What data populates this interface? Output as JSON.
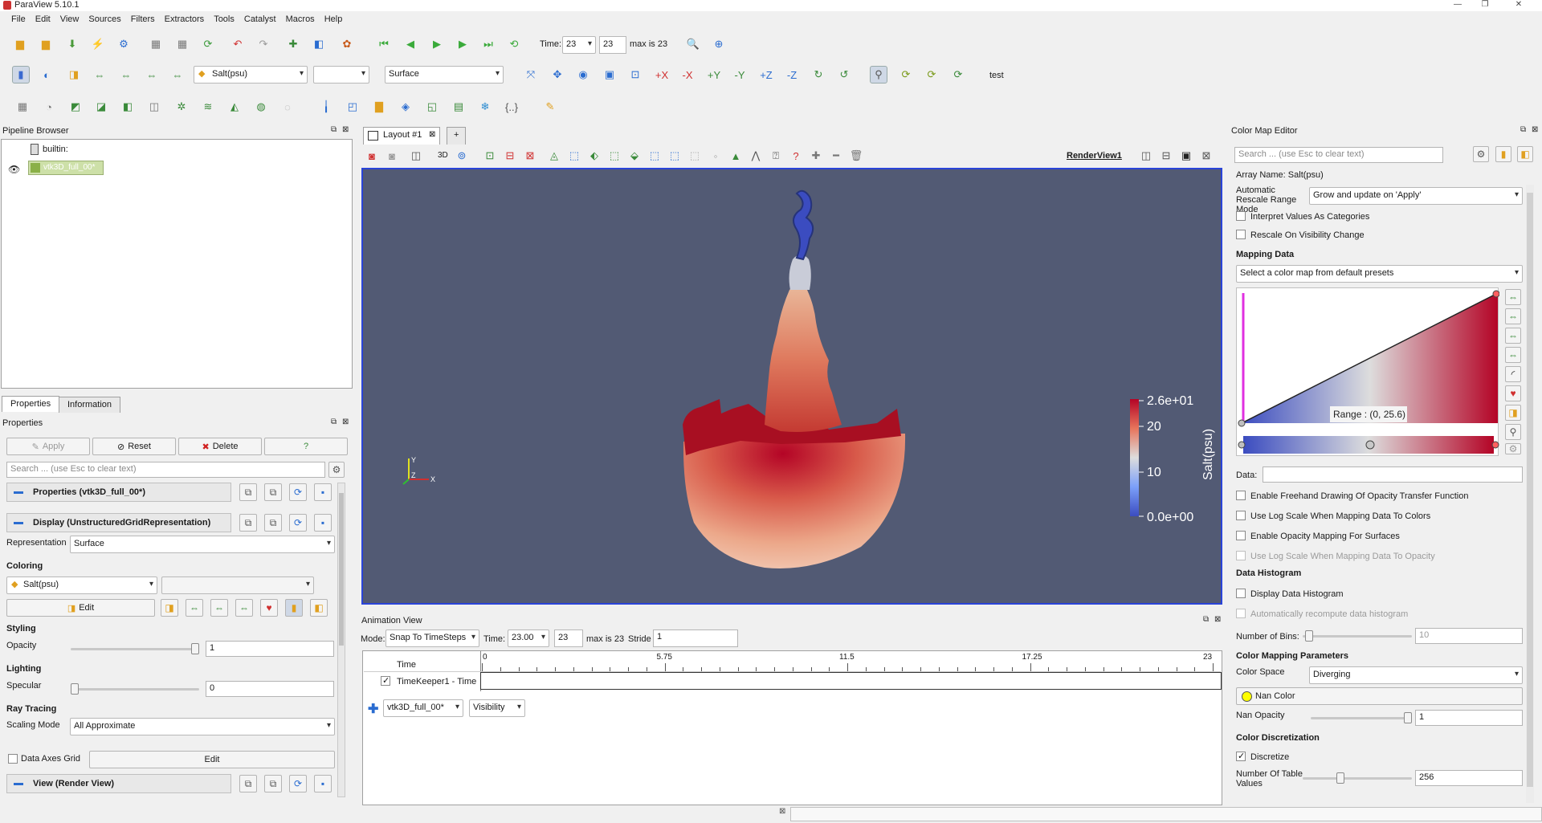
{
  "app": {
    "title": "ParaView 5.10.1"
  },
  "menu": [
    "File",
    "Edit",
    "View",
    "Sources",
    "Filters",
    "Extractors",
    "Tools",
    "Catalyst",
    "Macros",
    "Help"
  ],
  "time_toolbar": {
    "time_label": "Time:",
    "time_combo": "23",
    "time_spin": "23",
    "max_label": "max is 23"
  },
  "display_toolbar": {
    "array": "Salt(psu)",
    "component": "",
    "representation": "Surface",
    "test_label": "test"
  },
  "pipeline": {
    "title": "Pipeline Browser",
    "builtin": "builtin:",
    "source": "vtk3D_full_00*"
  },
  "tabs": {
    "properties": "Properties",
    "information": "Information"
  },
  "properties": {
    "title": "Properties",
    "apply": "Apply",
    "reset": "Reset",
    "delete": "Delete",
    "help": "?",
    "search_placeholder": "Search ... (use Esc to clear text)",
    "group_props": "Properties (vtk3D_full_00*)",
    "group_display": "Display (UnstructuredGridRepresentation)",
    "representation_label": "Representation",
    "representation_value": "Surface",
    "coloring": "Coloring",
    "coloring_array": "Salt(psu)",
    "coloring_component": "",
    "edit": "Edit",
    "styling": "Styling",
    "opacity_label": "Opacity",
    "opacity_value": "1",
    "lighting": "Lighting",
    "specular_label": "Specular",
    "specular_value": "0",
    "raytracing": "Ray Tracing",
    "scaling_label": "Scaling Mode",
    "scaling_value": "All Approximate",
    "axes_grid": "Data Axes Grid",
    "axes_edit": "Edit",
    "group_view": "View (Render View)"
  },
  "layout": {
    "tab": "Layout #1",
    "plus": "+",
    "view_name": "RenderView1",
    "mode3d": "3D"
  },
  "colorbar": {
    "title": "Salt(psu)",
    "ticks": [
      "2.6e+01",
      "20",
      "10",
      "0.0e+00"
    ]
  },
  "orientation": {
    "y": "Y",
    "z": "Z",
    "x": "X"
  },
  "animation": {
    "title": "Animation View",
    "mode_label": "Mode:",
    "mode_value": "Snap To TimeSteps",
    "time_label": "Time:",
    "time_value": "23.00",
    "time_spin": "23",
    "max_label": "max is 23",
    "stride_label": "Stride",
    "stride_value": "1",
    "col_time": "Time",
    "ticks": [
      "0",
      "5.75",
      "11.5",
      "17.25",
      "23"
    ],
    "track": "TimeKeeper1 - Time",
    "source_combo": "vtk3D_full_00*",
    "prop_combo": "Visibility"
  },
  "cme": {
    "title": "Color Map Editor",
    "search_placeholder": "Search ... (use Esc to clear text)",
    "array_name": "Array Name: Salt(psu)",
    "auto_rescale_label": "Automatic Rescale Range Mode",
    "auto_rescale_value": "Grow and update on 'Apply'",
    "interpret": "Interpret Values As Categories",
    "rescale_vis": "Rescale On Visibility Change",
    "mapping_data": "Mapping Data",
    "preset": "Select a color map from default presets",
    "range": "Range : (0, 25.6)",
    "data_label": "Data:",
    "freehand": "Enable Freehand Drawing Of Opacity Transfer Function",
    "log_colors": "Use Log Scale When Mapping Data To Colors",
    "opacity_surfaces": "Enable Opacity Mapping For Surfaces",
    "log_opacity": "Use Log Scale When Mapping Data To Opacity",
    "histogram": "Data Histogram",
    "display_hist": "Display Data Histogram",
    "auto_hist": "Automatically recompute data histogram",
    "bins_label": "Number of Bins:",
    "bins_value": "10",
    "cmp": "Color Mapping Parameters",
    "space_label": "Color Space",
    "space_value": "Diverging",
    "nan_color": "Nan Color",
    "nan_opacity_label": "Nan Opacity",
    "nan_opacity_value": "1",
    "discretization": "Color Discretization",
    "discretize": "Discretize",
    "table_values_label": "Number Of Table Values",
    "table_values_value": "256"
  },
  "colors": {
    "view_bg": "#525a74",
    "accent": "#2a6cd0",
    "warm": "#b40426",
    "cool": "#3b4cc0"
  }
}
